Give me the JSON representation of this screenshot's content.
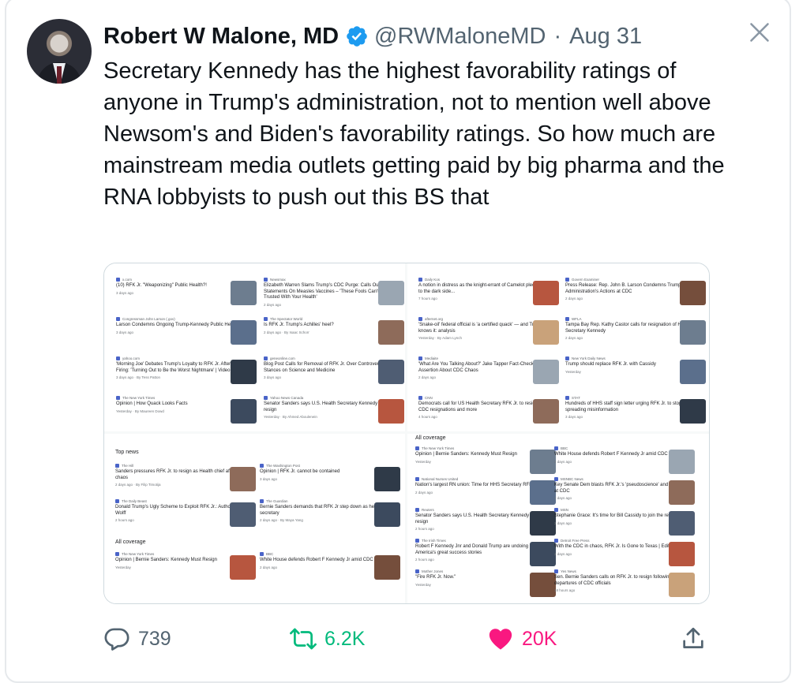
{
  "author": {
    "name": "Robert W Malone, MD",
    "handle": "@RWMaloneMD",
    "separator": "·",
    "date": "Aug 31"
  },
  "tweet": {
    "text": "Secretary Kennedy has the highest favorability ratings of anyone in Trump's administration, not to mention well above Newsom's and Biden's favorability ratings. So how much are mainstream media outlets getting paid by big pharma and the RNA lobbyists to push out this BS that"
  },
  "media": {
    "top_left": [
      {
        "source": "x.com",
        "headline": "(10) RFK Jr. \"Weaponizing\" Public Health?!",
        "meta": "3 days ago"
      },
      {
        "source": "Newsmax",
        "headline": "Elizabeth Warren Slams Trump's CDC Purge: Calls Out RFK Jr.'s Statements On Measles Vaccines – 'These Fools Can't Be Trusted With Your Health'",
        "meta": "2 days ago"
      },
      {
        "source": "Congressman John Larson (.gov)",
        "headline": "Larson Condemns Ongoing Trump-Kennedy Public Health Purge",
        "meta": "3 days ago"
      },
      {
        "source": "The Spectator World",
        "headline": "Is RFK Jr. Trump's Achilles' heel?",
        "meta": "2 days ago · By Isaac Schorr"
      },
      {
        "source": "yahoo.com",
        "headline": "'Morning Joe' Debates Trump's Loyalty to RFK Jr. After CDC Firing: 'Turning Out to Be the Worst Nightmare' | Video",
        "meta": "3 days ago · By Tess Patton"
      },
      {
        "source": "geneonline.com",
        "headline": "Blog Post Calls for Removal of RFK Jr. Over Controversial Stances on Science and Medicine",
        "meta": "3 days ago"
      },
      {
        "source": "The New York Times",
        "headline": "Opinion | How Quack Looks Facts",
        "meta": "Yesterday · By Maureen Dowd"
      },
      {
        "source": "Yahoo News Canada",
        "headline": "Senator Sanders says U.S. Health Secretary Kennedy must resign",
        "meta": "Yesterday · By Ahmed Aboulenein"
      }
    ],
    "top_right": [
      {
        "source": "Daily Kos",
        "headline": "A notion in distress as the knight-errant of Camelot pledges fealty to the dark side...",
        "meta": "7 hours ago"
      },
      {
        "source": "Govern Examiner",
        "headline": "Press Release: Rep. John B. Larson Condemns Trump Administration's Actions at CDC",
        "meta": "2 days ago"
      },
      {
        "source": "afternet.org",
        "headline": "'Snake-oil' federal official is 'a certified quack' — and Trump knows it: analysis",
        "meta": "Yesterday · By Adam Lynch"
      },
      {
        "source": "WFLA",
        "headline": "Tampa Bay Rep. Kathy Castor calls for resignation of HHS Secretary Kennedy",
        "meta": "2 days ago"
      },
      {
        "source": "Mediaite",
        "headline": "'What Are You Talking About?' Jake Tapper Fact-Checks RFK Jr.'s Assertion About CDC Chaos",
        "meta": "2 days ago"
      },
      {
        "source": "New York Daily News",
        "headline": "Trump should replace RFK Jr. with Cassidy",
        "meta": "Yesterday"
      },
      {
        "source": "CNN",
        "headline": "Democrats call for US Health Secretary RFK Jr. to resign amid CDC resignations and more",
        "meta": "4 hours ago"
      },
      {
        "source": "STAT",
        "headline": "Hundreds of HHS staff sign letter urging RFK Jr. to stop spreading misinformation",
        "meta": "3 days ago"
      }
    ],
    "bottom_left": {
      "top_news_label": "Top news",
      "all_coverage_label": "All coverage",
      "items": [
        {
          "source": "The Hill",
          "headline": "Sanders pressures RFK Jr. to resign as Health chief after CDC chaos",
          "meta": "2 days ago · By Filip Timotija"
        },
        {
          "source": "The Washington Post",
          "headline": "Opinion | RFK Jr. cannot be contained",
          "meta": "3 days ago"
        },
        {
          "source": "The Daily Beast",
          "headline": "Donald Trump's Ugly Scheme to Exploit RFK Jr.: Author Michael Wolff",
          "meta": "2 hours ago"
        },
        {
          "source": "The Guardian",
          "headline": "Bernie Sanders demands that RFK Jr step down as health secretary",
          "meta": "2 days ago · By Maya Yang"
        },
        {
          "source": "The New York Times",
          "headline": "Opinion | Bernie Sanders: Kennedy Must Resign",
          "meta": "Yesterday"
        },
        {
          "source": "BBC",
          "headline": "White House defends Robert F Kennedy Jr amid CDC turmoil",
          "meta": "2 days ago"
        }
      ]
    },
    "bottom_right": {
      "all_coverage_label": "All coverage",
      "items": [
        {
          "source": "The New York Times",
          "headline": "Opinion | Bernie Sanders: Kennedy Must Resign",
          "meta": "Yesterday"
        },
        {
          "source": "BBC",
          "headline": "White House defends Robert F Kennedy Jr amid CDC turmoil",
          "meta": "2 days ago"
        },
        {
          "source": "National Nurses United",
          "headline": "Nation's largest RN union: Time for HHS Secretary RFK Jr. to go",
          "meta": "2 days ago"
        },
        {
          "source": "MSNBC News",
          "headline": "Key Senate Dem blasts RFK Jr.'s 'pseudoscience' and 'quackery' at CDC",
          "meta": "2 days ago"
        },
        {
          "source": "Reuters",
          "headline": "Senator Sanders says U.S. Health Secretary Kennedy must resign",
          "meta": "2 hours ago"
        },
        {
          "source": "MSN",
          "headline": "Stephanie Grace: It's time for Bill Cassidy to join the resistance",
          "meta": "2 days ago"
        },
        {
          "source": "The Irish Times",
          "headline": "Robert F Kennedy Jnr and Donald Trump are undoing one of America's great success stories",
          "meta": "2 hours ago"
        },
        {
          "source": "Detroit Free Press",
          "headline": "With the CDC in chaos, RFK Jr. Is Gone to Texas | Editorial",
          "meta": "2 days ago"
        },
        {
          "source": "Mother Jones",
          "headline": "\"Fire RFK Jr. Now.\"",
          "meta": "Yesterday"
        },
        {
          "source": "Yes News",
          "headline": "Sen. Bernie Sanders calls on RFK Jr. to resign following departures of CDC officials",
          "meta": "18 hours ago"
        }
      ]
    }
  },
  "stats": {
    "replies": "739",
    "retweets": "6.2K",
    "likes": "20K"
  },
  "colors": {
    "verified": "#1d9bf0",
    "retweet": "#00ba7c",
    "like": "#f91880",
    "muted": "#536471"
  }
}
